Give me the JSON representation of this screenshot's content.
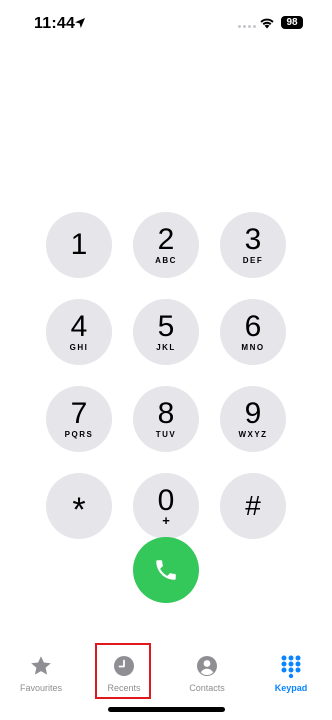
{
  "status_bar": {
    "time": "11:44",
    "battery": "98"
  },
  "keypad": {
    "keys": [
      {
        "digit": "1",
        "letters": ""
      },
      {
        "digit": "2",
        "letters": "ABC"
      },
      {
        "digit": "3",
        "letters": "DEF"
      },
      {
        "digit": "4",
        "letters": "GHI"
      },
      {
        "digit": "5",
        "letters": "JKL"
      },
      {
        "digit": "6",
        "letters": "MNO"
      },
      {
        "digit": "7",
        "letters": "PQRS"
      },
      {
        "digit": "8",
        "letters": "TUV"
      },
      {
        "digit": "9",
        "letters": "WXYZ"
      },
      {
        "digit": "*",
        "letters": ""
      },
      {
        "digit": "0",
        "letters": "+"
      },
      {
        "digit": "#",
        "letters": ""
      }
    ]
  },
  "tab_bar": {
    "tabs": [
      {
        "label": "Favourites",
        "icon": "star-icon",
        "active": false
      },
      {
        "label": "Recents",
        "icon": "clock-icon",
        "active": false
      },
      {
        "label": "Contacts",
        "icon": "person-icon",
        "active": false
      },
      {
        "label": "Keypad",
        "icon": "keypad-grid-icon",
        "active": true
      }
    ]
  },
  "colors": {
    "call_green": "#34c759",
    "key_gray": "#e5e5ea",
    "active_blue": "#0a84ff",
    "inactive_gray": "#8e8e93",
    "highlight_red": "#e0191e"
  }
}
